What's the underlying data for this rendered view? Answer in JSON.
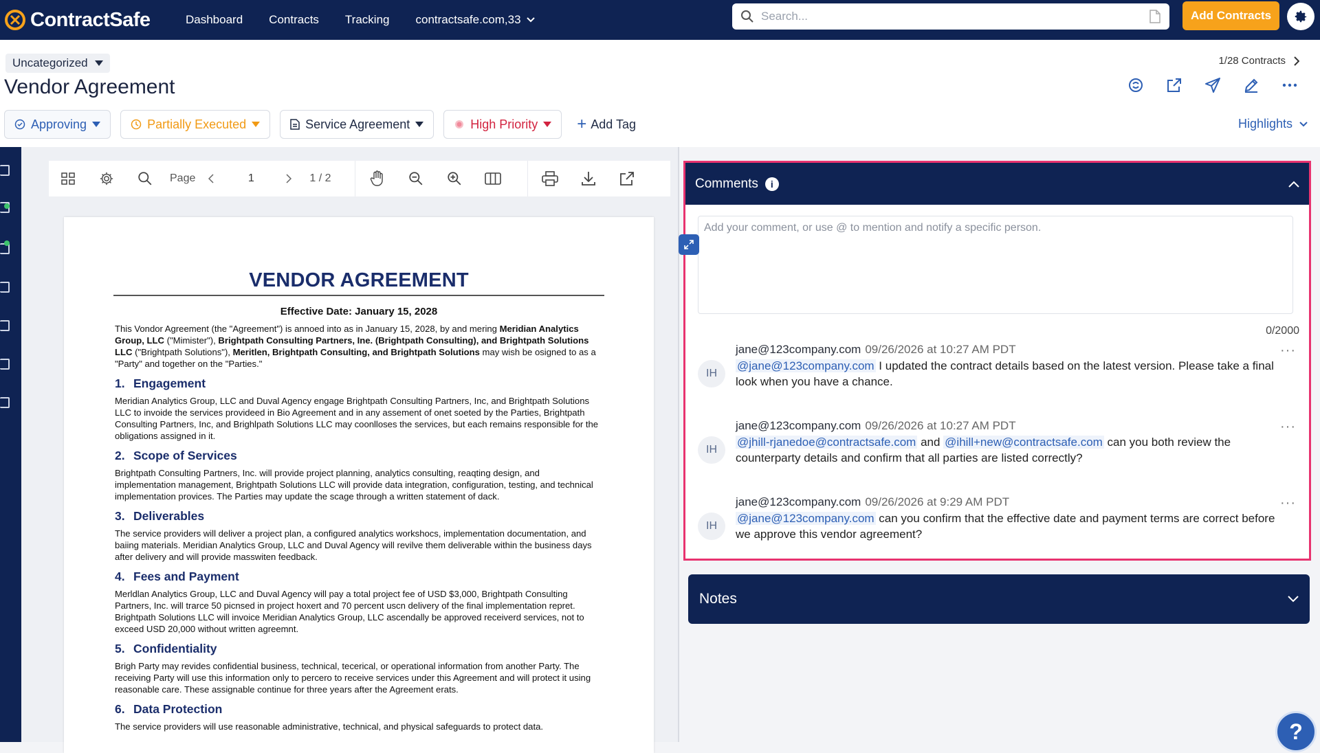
{
  "app": {
    "brand": "ContractSafe"
  },
  "nav": {
    "items": [
      "Dashboard",
      "Contracts",
      "Tracking"
    ],
    "account": "contractsafe.com,33"
  },
  "search": {
    "placeholder": "Search..."
  },
  "actions": {
    "add_contracts": "Add Contracts"
  },
  "header": {
    "folder": "Uncategorized",
    "title": "Vendor Agreement",
    "counter": "1/28 Contracts",
    "highlights": "Highlights"
  },
  "chips": {
    "approving": "Approving",
    "partial": "Partially Executed",
    "service": "Service Agreement",
    "priority": "High Priority",
    "add_tag": "Add Tag"
  },
  "toolbar": {
    "page_label": "Page",
    "page_value": "1",
    "page_total": "1 / 2"
  },
  "document": {
    "title": "VENDOR AGREEMENT",
    "effective": "Effective Date: January 15, 2028",
    "intro_parts": [
      "This Vondor Agreement (the \"Agreement\") is annoed into as in January 15, 2028, by and mering ",
      "Meridian Analytics Group, LLC",
      " (\"Mimister\"), ",
      "Brightpath Consulting Partners, Ine. (Brightpath Consulting), and Brightpath Solutions LLC",
      " (\"Brightpath Solutions\"), ",
      "Meritlen, Brightpath Consulting, and Brightpath Solutions",
      " may wish be osigned to as a \"Party\" and together on the \"Parties.\""
    ],
    "sections": [
      {
        "num": "1.",
        "heading": "Engagement",
        "text": "Meridian Analytics Group, LLC and Duval Agency engage Brightpath Consulting Partners, Inc, and Brightpath Solutions LLC to invoide the services provideed in Bio Agreement and in any assement of onet soeted by the Parties, Brightpath Consulting Partners, Inc, and Brighlpath Solutions LLC may coonlloses the services, but each remains responsible for the obligations assigned in it."
      },
      {
        "num": "2.",
        "heading": "Scope of Services",
        "text": "Brightpath Consulting Partners, Inc. will provide project planning, analytics consulting, reaqting design, and implementation management, Brightpath Solutions LLC will provide data integration, configuration, testing, and technical implementation provices. The Parties may update the scage through a written statement of dack."
      },
      {
        "num": "3.",
        "heading": "Deliverables",
        "text": "The service providers will deliver a project plan, a configured analytics workshocs, implementation documentation, and baiing materials. Meridian Analytics Group, LLC and Duval Agency will revilve them deliverable within the business days after delivery and will provide masswiten feedback."
      },
      {
        "num": "4.",
        "heading": "Fees and Payment",
        "text": "Merldlan Analytics Group, LLC and Duval Agency will pay a total project fee of USD $3,000, Brightpath Consulting Partners, Inc. will trarce 50 picnsed in project hoxert and 70 percent uscn delivery of the final implementation repret. Brightpath Solutions LLC will invoice Meridian Analytics Group, LLC ascendally be approved receiverd services, not to exceed USD 20,000 without written agreemnt."
      },
      {
        "num": "5.",
        "heading": "Confidentiality",
        "text": "Brigh Party may revides confidential business, technical, tecerical, or operational information from another Party. The receiving Party will use this information only to percero to receive services under this Agreement and will protect it using reasonable care. These assignable continue for three years after the Agreement erats."
      },
      {
        "num": "6.",
        "heading": "Data Protection",
        "text": "The service providers will use reasonable administrative, technical, and physical safeguards to protect data."
      }
    ]
  },
  "comments": {
    "title": "Comments",
    "info": "i",
    "placeholder": "Add your comment, or use @ to mention and notify a specific person.",
    "char_count": "0/2000",
    "items": [
      {
        "initials": "IH",
        "author": "jane@123company.com",
        "time": "09/26/2026 at 10:27 AM PDT",
        "mention1": "@jane@123company.com",
        "text1": " I updated the contract details based on the latest version. Please take a final look when you have a chance."
      },
      {
        "initials": "IH",
        "author": "jane@123company.com",
        "time": "09/26/2026 at 10:27 AM PDT",
        "mention1": "@jhill-rjanedoe@contractsafe.com",
        "text1": " and ",
        "mention2": "@ihill+new@contractsafe.com",
        "text2": " can you both review the counterparty details and confirm that all parties are listed correctly?"
      },
      {
        "initials": "IH",
        "author": "jane@123company.com",
        "time": "09/26/2026 at 9:29 AM PDT",
        "mention1": "@jane@123company.com",
        "text1": " can you confirm that the effective date and payment terms are correct before we approve this vendor agreement?"
      }
    ]
  },
  "notes": {
    "title": "Notes"
  },
  "help": {
    "label": "?"
  },
  "colors": {
    "navy": "#0f2353",
    "accent": "#f7a21b",
    "link": "#2d5fb4",
    "highlight_border": "#e8336f",
    "priority": "#d2233f",
    "partial": "#f19a14"
  }
}
